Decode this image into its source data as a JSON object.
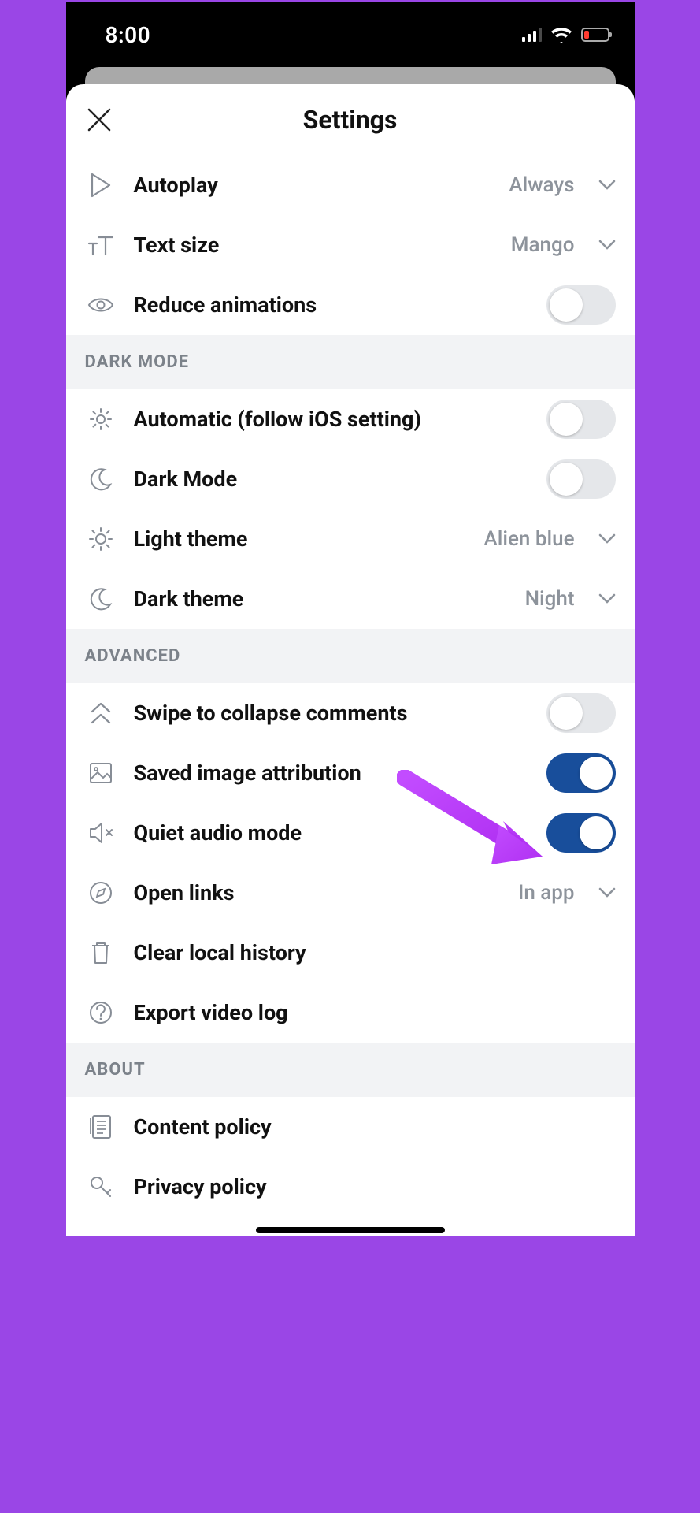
{
  "status": {
    "time": "8:00"
  },
  "header": {
    "title": "Settings"
  },
  "sections": {
    "general": {
      "autoplay": {
        "label": "Autoplay",
        "value": "Always"
      },
      "text_size": {
        "label": "Text size",
        "value": "Mango"
      },
      "reduce_animations": {
        "label": "Reduce animations"
      }
    },
    "dark_mode": {
      "title": "DARK MODE",
      "auto": {
        "label": "Automatic (follow iOS setting)"
      },
      "dark": {
        "label": "Dark Mode"
      },
      "light_theme": {
        "label": "Light theme",
        "value": "Alien blue"
      },
      "dark_theme": {
        "label": "Dark theme",
        "value": "Night"
      }
    },
    "advanced": {
      "title": "ADVANCED",
      "swipe_collapse": {
        "label": "Swipe to collapse comments"
      },
      "saved_img": {
        "label": "Saved image attribution"
      },
      "quiet_audio": {
        "label": "Quiet audio mode"
      },
      "open_links": {
        "label": "Open links",
        "value": "In app"
      },
      "clear_history": {
        "label": "Clear local history"
      },
      "export_video": {
        "label": "Export video log"
      }
    },
    "about": {
      "title": "ABOUT",
      "content_policy": {
        "label": "Content policy"
      },
      "privacy_policy": {
        "label": "Privacy policy"
      }
    }
  }
}
